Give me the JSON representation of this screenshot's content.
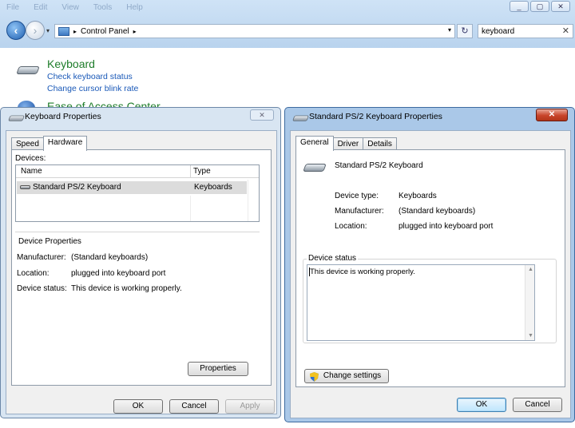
{
  "explorer": {
    "menu": [
      "File",
      "Edit",
      "View",
      "Tools",
      "Help"
    ],
    "address": "Control Panel",
    "search_value": "keyboard",
    "results": {
      "keyboard_title": "Keyboard",
      "keyboard_link1": "Check keyboard status",
      "keyboard_link2": "Change cursor blink rate",
      "ease_title": "Ease of Access Center"
    }
  },
  "left_dialog": {
    "title": "Keyboard Properties",
    "tabs": [
      "Speed",
      "Hardware"
    ],
    "active_tab": "Hardware",
    "devices_label": "Devices:",
    "columns": [
      "Name",
      "Type"
    ],
    "rows": [
      {
        "name": "Standard PS/2 Keyboard",
        "type": "Keyboards"
      }
    ],
    "props_title": "Device Properties",
    "manufacturer_label": "Manufacturer:",
    "manufacturer_value": "(Standard keyboards)",
    "location_label": "Location:",
    "location_value": "plugged into keyboard port",
    "status_label": "Device status:",
    "status_value": "This device is working properly.",
    "properties_button": "Properties",
    "ok_button": "OK",
    "cancel_button": "Cancel",
    "apply_button": "Apply"
  },
  "right_dialog": {
    "title": "Standard PS/2 Keyboard Properties",
    "tabs": [
      "General",
      "Driver",
      "Details"
    ],
    "active_tab": "General",
    "device_name": "Standard PS/2 Keyboard",
    "device_type_label": "Device type:",
    "device_type_value": "Keyboards",
    "manufacturer_label": "Manufacturer:",
    "manufacturer_value": "(Standard keyboards)",
    "location_label": "Location:",
    "location_value": "plugged into keyboard port",
    "status_legend": "Device status",
    "status_text": "This device is working properly.",
    "change_settings_button": "Change settings",
    "ok_button": "OK",
    "cancel_button": "Cancel"
  },
  "colors": {
    "link": "#1a59b8",
    "title_green": "#1e7d2a",
    "close_red": "#c8442a"
  }
}
